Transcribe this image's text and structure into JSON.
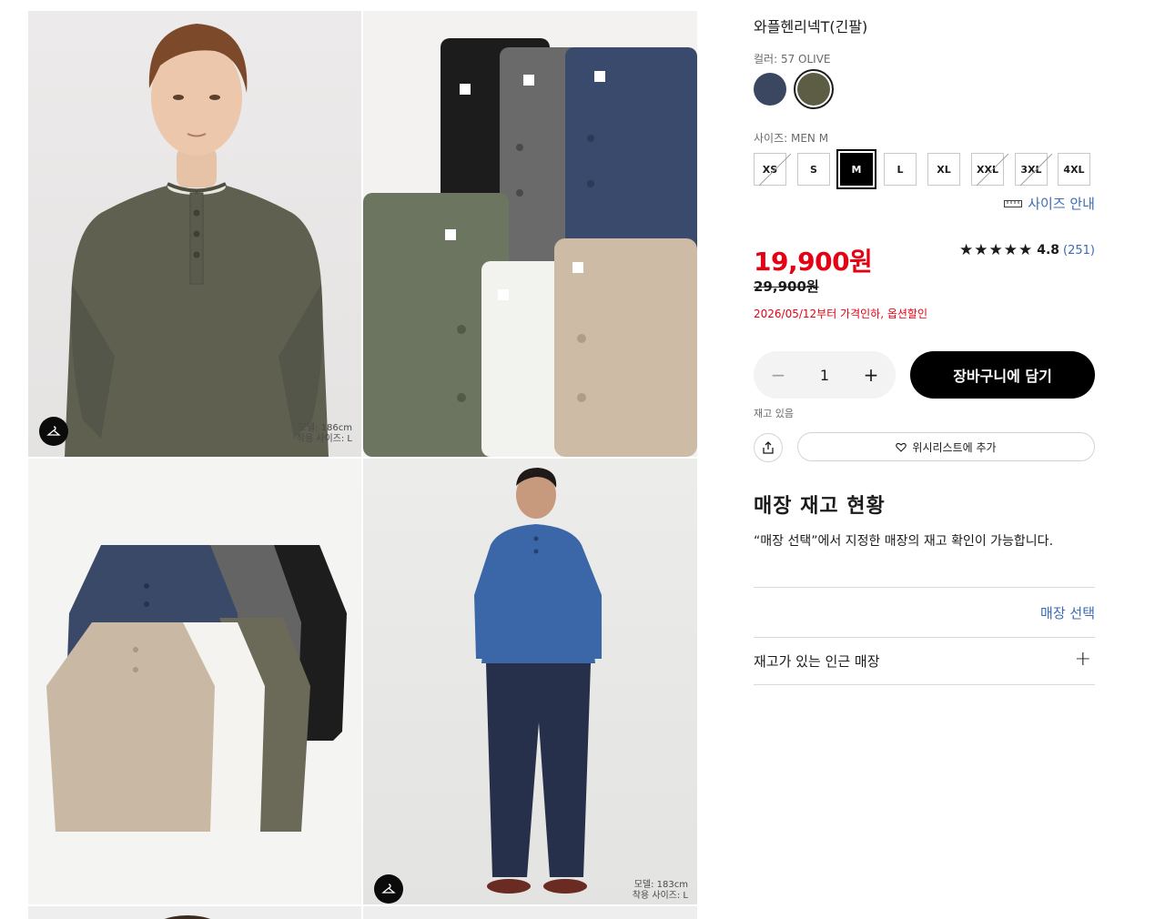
{
  "product": {
    "title": "와플헨리넥T(긴팔)",
    "color_label": "컬러: 57 OLIVE",
    "colors": [
      {
        "name": "NAVY",
        "hex": "#3b4660"
      },
      {
        "name": "57 OLIVE",
        "hex": "#5d5c45"
      }
    ],
    "size_label": "사이즈: MEN M",
    "sizes": [
      {
        "label": "XS",
        "state": "disabled"
      },
      {
        "label": "S",
        "state": "available"
      },
      {
        "label": "M",
        "state": "selected"
      },
      {
        "label": "L",
        "state": "available"
      },
      {
        "label": "XL",
        "state": "available"
      },
      {
        "label": "XXL",
        "state": "disabled"
      },
      {
        "label": "3XL",
        "state": "disabled"
      },
      {
        "label": "4XL",
        "state": "available"
      }
    ],
    "size_guide": "사이즈 안내",
    "price": "19,900원",
    "original_price": "29,900원",
    "price_note": "2026/05/12부터 가격인하,  옵션할인",
    "rating": {
      "stars": "★★★★★",
      "value": "4.8",
      "count": "(251)"
    },
    "quantity": "1",
    "add_to_cart": "장바구니에 담기",
    "stock_status": "재고 있음",
    "wishlist": "위시리스트에 추가"
  },
  "store": {
    "heading": "매장 재고 현황",
    "description": "“매장 선택”에서 지정한 매장의 재고 확인이 가능합니다.",
    "select_link": "매장 선택",
    "nearby_label": "재고가 있는 인근 매장"
  },
  "gallery": {
    "images": [
      {
        "alt": "model-olive-front",
        "model_height": "모델: 186cm",
        "fit_size": "착용 사이즈: L"
      },
      {
        "alt": "folded-colors"
      },
      {
        "alt": "flatlay-colors"
      },
      {
        "alt": "model-blue-full",
        "model_height": "모델: 183cm",
        "fit_size": "착용 사이즈: L"
      }
    ]
  },
  "colors": {
    "accent_red": "#e60013",
    "link_blue": "#3b6bb5",
    "black": "#000000"
  }
}
